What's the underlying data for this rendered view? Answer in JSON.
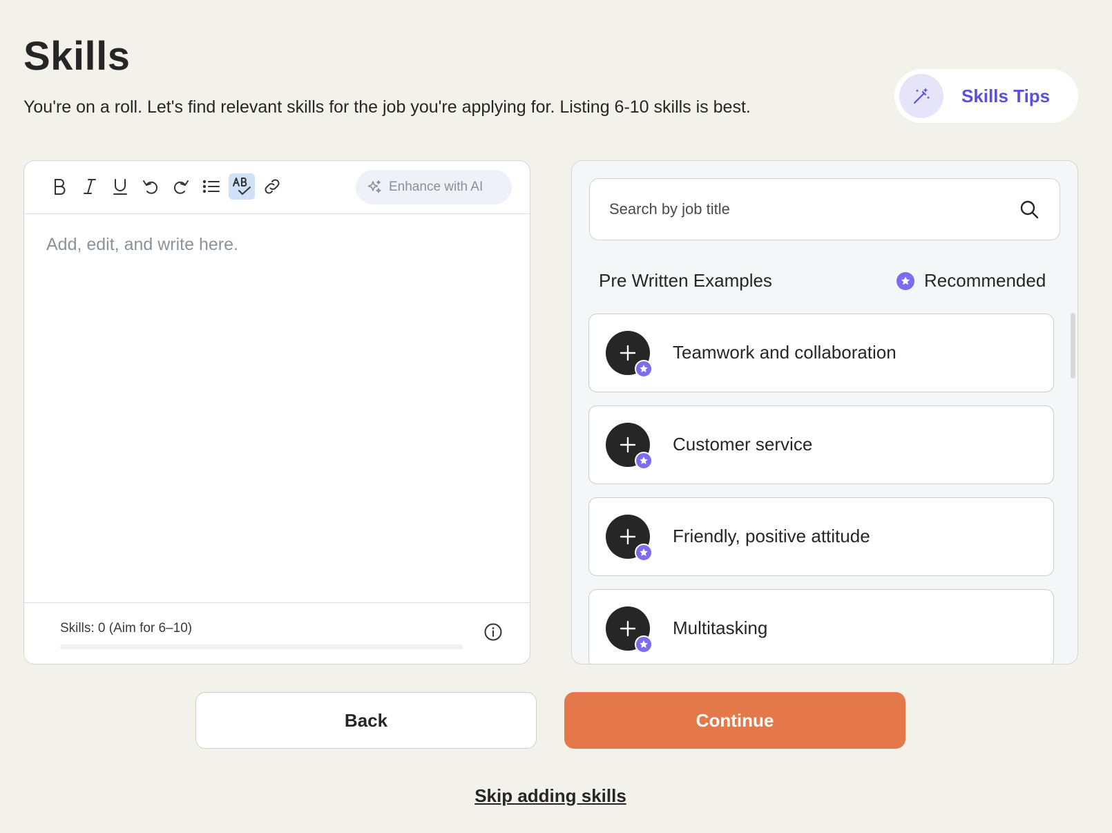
{
  "header": {
    "title": "Skills",
    "subtitle": "You're on a roll. Let's find relevant skills for the job you're applying for. Listing 6-10 skills is best."
  },
  "tips": {
    "label": "Skills Tips",
    "icon": "magic-wand-icon"
  },
  "editor": {
    "toolbar": {
      "bold": "B",
      "enhance_label": "Enhance with AI"
    },
    "placeholder": "Add, edit, and write here.",
    "skills_count_label": "Skills: 0 (Aim for 6–10)",
    "skills_count": 0,
    "progress_fraction": 0
  },
  "examples": {
    "search_placeholder": "Search by job title",
    "section_title": "Pre Written Examples",
    "recommended_label": "Recommended",
    "items": [
      {
        "label": "Teamwork and collaboration"
      },
      {
        "label": "Customer service"
      },
      {
        "label": "Friendly, positive attitude"
      },
      {
        "label": "Multitasking"
      }
    ]
  },
  "actions": {
    "back_label": "Back",
    "continue_label": "Continue",
    "skip_label": "Skip adding skills"
  },
  "colors": {
    "background": "#f2f2eb",
    "accent_purple": "#5b4fe0",
    "continue_orange": "#e5784a",
    "text_dark": "#262626"
  }
}
